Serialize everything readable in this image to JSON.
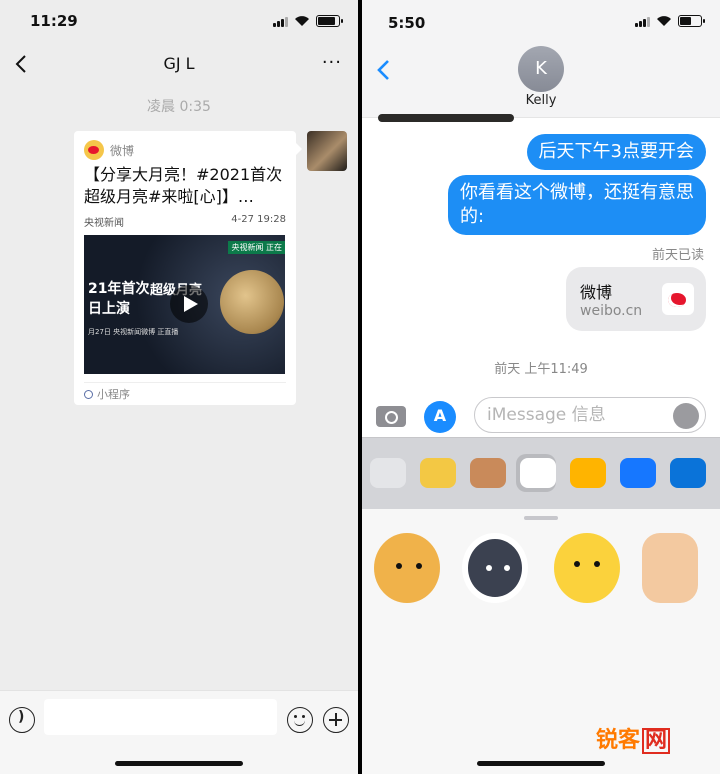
{
  "left_panel": {
    "status": {
      "time": "11:29"
    },
    "nav": {
      "title": "GJ L",
      "more": "···"
    },
    "timestamp": "凌晨 0:35",
    "card": {
      "source": "微博",
      "text": "【分享大月亮！#2021首次超级月亮#来啦[心]】…",
      "publisher": "央视新闻",
      "date": "4-27 19:28",
      "image_text_1": "21年首次",
      "image_text_2": "超级月亮",
      "image_text_3": "日上演",
      "image_tag": "央视新闻 正在",
      "image_strip": "月27日 央视新闻微博 正直播",
      "footer": "小程序"
    },
    "icons": {
      "back": "chevron-left-icon",
      "voice": "voice-icon",
      "emoji": "emoji-icon",
      "plus": "plus-icon"
    }
  },
  "right_panel": {
    "status": {
      "time": "5:50"
    },
    "contact": {
      "initial": "K",
      "name": "Kelly"
    },
    "messages": [
      {
        "text": "后天下午3点要开会",
        "from": "me"
      },
      {
        "text": "你看看这个微博，还挺有意思的:",
        "from": "me"
      }
    ],
    "read_receipt": "前天已读",
    "link_preview": {
      "title": "微博",
      "domain": "weibo.cn"
    },
    "timestamp": "前天 上午11:49",
    "input_placeholder": "iMessage 信息",
    "apps": [
      "photos",
      "line-stickers",
      "line-brown",
      "weibo",
      "video",
      "alipay",
      "onedrive"
    ],
    "icons": {
      "camera": "camera-icon",
      "appstore": "appstore-icon",
      "mic": "mic-icon"
    }
  },
  "watermark": {
    "text_1": "锐客",
    "text_2": "网"
  },
  "colors": {
    "imessage_blue": "#1d8ef5",
    "weibo_red": "#e6162d",
    "wechat_bg": "#ededed"
  }
}
